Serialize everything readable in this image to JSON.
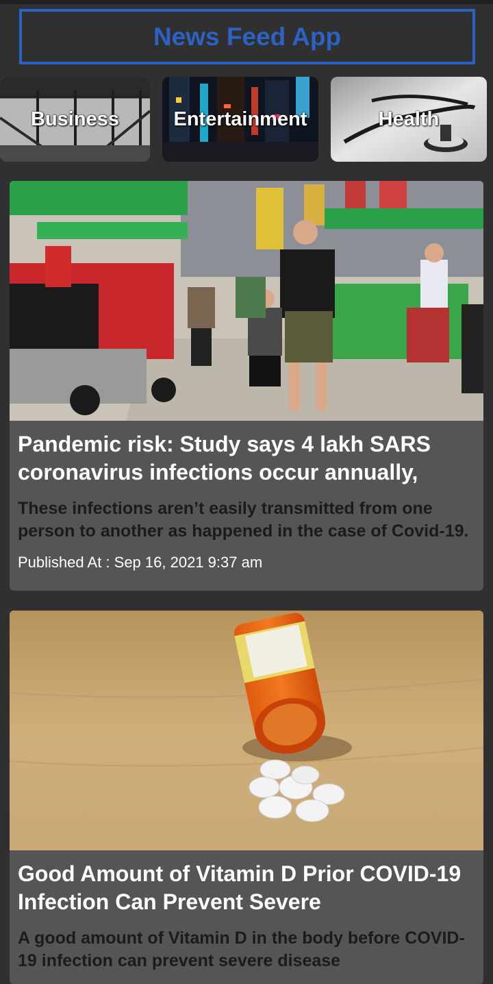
{
  "app": {
    "title": "News Feed App"
  },
  "categories": [
    {
      "label": "Business"
    },
    {
      "label": "Entertainment"
    },
    {
      "label": "Health"
    }
  ],
  "articles": [
    {
      "title": "Pandemic risk: Study says 4 lakh SARS coronavirus infections occur annually,",
      "description": "These infections aren’t easily transmitted from one person to another as happened in the case of Covid-19.",
      "published": "Published At : Sep 16, 2021 9:37 am",
      "image_icon": "street-scene-image"
    },
    {
      "title": "Good Amount of Vitamin D Prior COVID-19 Infection Can Prevent Severe",
      "description": "A good amount of Vitamin D in the body before COVID-19 infection can prevent severe disease",
      "image_icon": "pill-bottle-image"
    }
  ],
  "colors": {
    "background": "#303030",
    "accent": "#2c62c4",
    "card": "#555555"
  }
}
